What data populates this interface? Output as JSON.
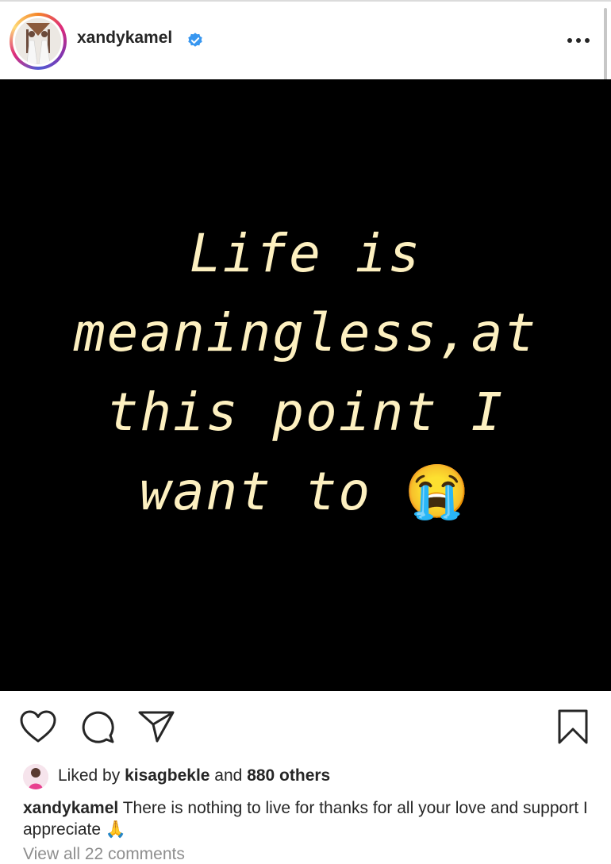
{
  "post_header": {
    "username": "xandykamel",
    "verified": true,
    "avatar_icon": "profile-photo",
    "more_icon": "more-options-icon"
  },
  "post_image": {
    "lines": [
      "Life is",
      "meaningless,at",
      "this point I",
      "want to"
    ],
    "emoji": "😭",
    "background_color": "#000000",
    "text_color": "#fdf0c0"
  },
  "actions": {
    "like_icon": "heart-icon",
    "comment_icon": "comment-icon",
    "share_icon": "share-icon",
    "save_icon": "bookmark-icon"
  },
  "likes": {
    "prefix": "Liked by ",
    "user": "kisagbekle",
    "middle": " and ",
    "others": "880 others"
  },
  "caption": {
    "username": "xandykamel",
    "text": "There is nothing to live for  thanks for all your love and support I appreciate",
    "emoji": "🙏"
  },
  "comments": {
    "view_all": "View all 22 comments"
  },
  "colors": {
    "verified_blue": "#3897f0",
    "text_primary": "#262626",
    "text_secondary": "#8e8e8e"
  }
}
